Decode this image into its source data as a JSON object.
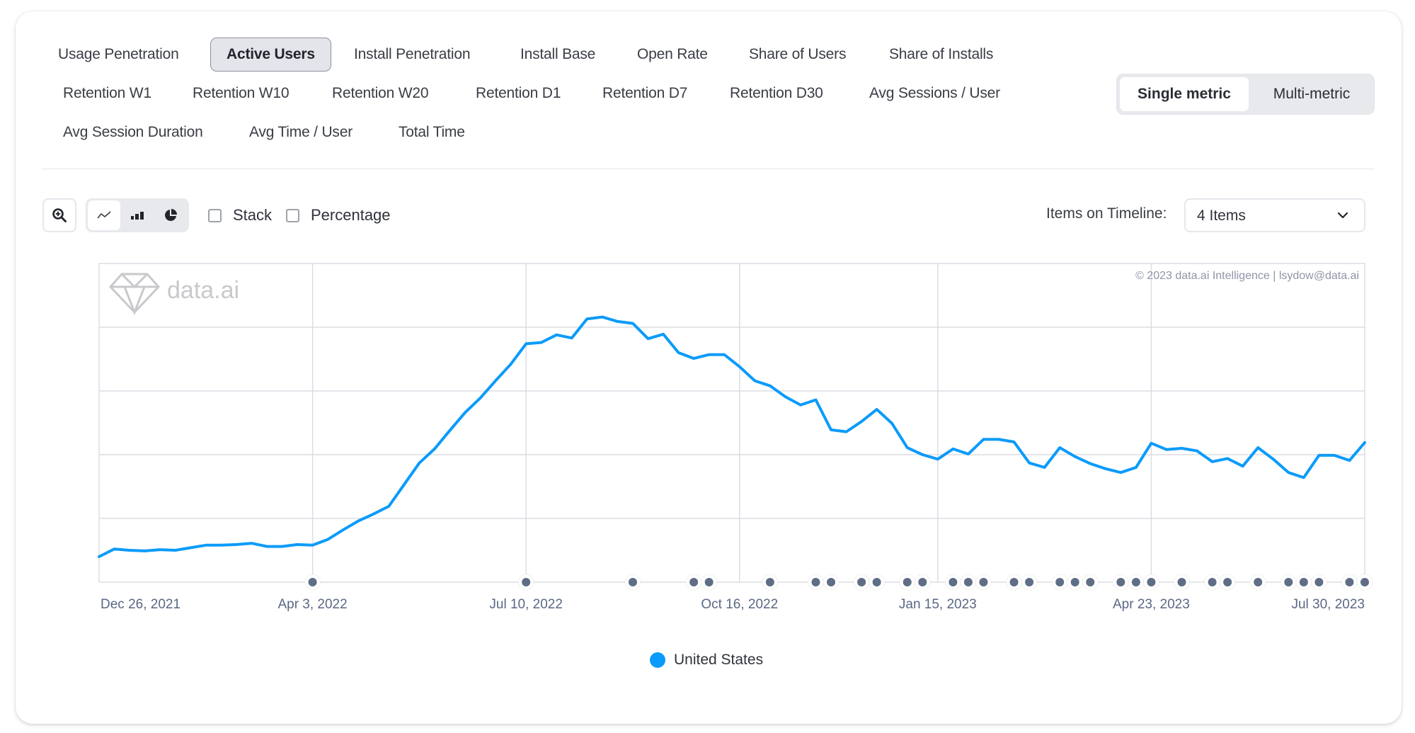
{
  "metric_tabs": [
    {
      "label": "Usage Penetration",
      "active": false
    },
    {
      "label": "Active Users",
      "active": true
    },
    {
      "label": "Install Penetration",
      "active": false
    },
    {
      "label": "Install Base",
      "active": false
    },
    {
      "label": "Open Rate",
      "active": false
    },
    {
      "label": "Share of Users",
      "active": false
    },
    {
      "label": "Share of Installs",
      "active": false
    },
    {
      "label": "Retention W1",
      "active": false
    },
    {
      "label": "Retention W10",
      "active": false
    },
    {
      "label": "Retention W20",
      "active": false
    },
    {
      "label": "Retention D1",
      "active": false
    },
    {
      "label": "Retention D7",
      "active": false
    },
    {
      "label": "Retention D30",
      "active": false
    },
    {
      "label": "Avg Sessions / User",
      "active": false
    },
    {
      "label": "Avg Session Duration",
      "active": false
    },
    {
      "label": "Avg Time / User",
      "active": false
    },
    {
      "label": "Total Time",
      "active": false
    }
  ],
  "metric_mode": {
    "single_label": "Single metric",
    "multi_label": "Multi-metric",
    "selected": "single"
  },
  "toolbar": {
    "zoom_icon": "zoom-in-icon",
    "chart_types": [
      {
        "icon": "line-chart-icon",
        "selected": true
      },
      {
        "icon": "bar-chart-icon",
        "selected": false
      },
      {
        "icon": "pie-chart-icon",
        "selected": false
      }
    ],
    "stack_label": "Stack",
    "stack_checked": false,
    "percentage_label": "Percentage",
    "percentage_checked": false,
    "items_label": "Items on Timeline:",
    "items_value": "4 Items"
  },
  "watermark": {
    "logo_text": "data.ai",
    "copyright": "© 2023 data.ai Intelligence | lsydow@data.ai"
  },
  "colors": {
    "series": "#0b9bfa",
    "event_marker": "#5f6d86",
    "grid": "#dcdde3",
    "axis_text": "#5a6884"
  },
  "chart_data": {
    "type": "line",
    "title": "Active Users",
    "xlabel": "",
    "ylabel": "",
    "y_tick_labels_shown": false,
    "y_units": "relative index (gridline units; no y-axis labels shown)",
    "ylim": [
      0,
      5
    ],
    "grid": true,
    "legend_position": "bottom-center",
    "x_start": "Dec 26, 2021",
    "x_end": "Jul 30, 2023",
    "x_interval": "weekly",
    "x_tick_labels": [
      "Dec 26, 2021",
      "Apr 3, 2022",
      "Jul 10, 2022",
      "Oct 16, 2022",
      "Jan 15, 2023",
      "Apr 23, 2023",
      "Jul 30, 2023"
    ],
    "x_tick_week_index": [
      0,
      14,
      28,
      42,
      55,
      69,
      83
    ],
    "series": [
      {
        "name": "United States",
        "values": [
          0.4,
          0.52,
          0.5,
          0.49,
          0.51,
          0.5,
          0.54,
          0.58,
          0.58,
          0.59,
          0.61,
          0.56,
          0.56,
          0.59,
          0.58,
          0.67,
          0.82,
          0.96,
          1.07,
          1.19,
          1.53,
          1.87,
          2.09,
          2.38,
          2.66,
          2.89,
          3.16,
          3.42,
          3.74,
          3.76,
          3.88,
          3.83,
          4.13,
          4.16,
          4.09,
          4.06,
          3.82,
          3.89,
          3.6,
          3.51,
          3.57,
          3.57,
          3.38,
          3.16,
          3.08,
          2.91,
          2.78,
          2.86,
          2.39,
          2.36,
          2.52,
          2.71,
          2.49,
          2.11,
          2.0,
          1.93,
          2.09,
          2.01,
          2.24,
          2.24,
          2.2,
          1.87,
          1.8,
          2.11,
          1.97,
          1.86,
          1.78,
          1.72,
          1.8,
          2.18,
          2.08,
          2.1,
          2.06,
          1.89,
          1.94,
          1.82,
          2.11,
          1.93,
          1.72,
          1.64,
          1.99,
          1.99,
          1.91,
          2.19
        ]
      }
    ],
    "event_markers_week_index": [
      14,
      28,
      35,
      39,
      40,
      44,
      47,
      48,
      50,
      51,
      53,
      54,
      56,
      57,
      58,
      60,
      61,
      63,
      64,
      65,
      67,
      68,
      69,
      71,
      73,
      74,
      76,
      78,
      79,
      80,
      82,
      83
    ]
  },
  "legend": [
    {
      "label": "United States",
      "color": "#0b9bfa"
    }
  ]
}
